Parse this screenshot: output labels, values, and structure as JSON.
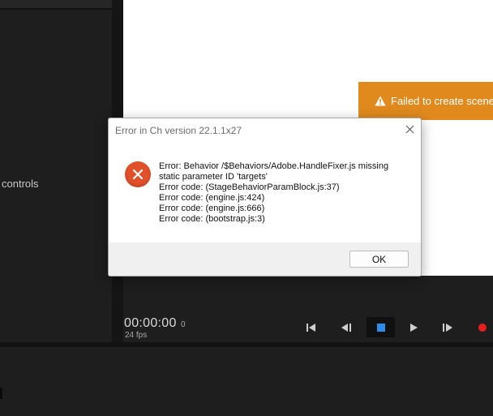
{
  "left_panel": {
    "controls_label": "controls"
  },
  "stage": {
    "banner_text": "Failed to create scene",
    "banner_icon": "warning-triangle-icon",
    "banner_color": "#e08a1e"
  },
  "timeline": {
    "timecode": "00:00:00",
    "frame": "0",
    "fps": "24 fps",
    "accent_color": "#2d8ceb",
    "record_color": "#e81e1e"
  },
  "dialog": {
    "title": "Error in Ch version 22.1.1x27",
    "icon": "error-circle-icon",
    "lines": [
      "Error: Behavior /$Behaviors/Adobe.HandleFixer.js missing",
      "static parameter ID 'targets'",
      "Error code: (StageBehaviorParamBlock.js:37)",
      "Error code: (engine.js:424)",
      "Error code: (engine.js:666)",
      "Error code: (bootstrap.js:3)"
    ],
    "ok_label": "OK"
  }
}
